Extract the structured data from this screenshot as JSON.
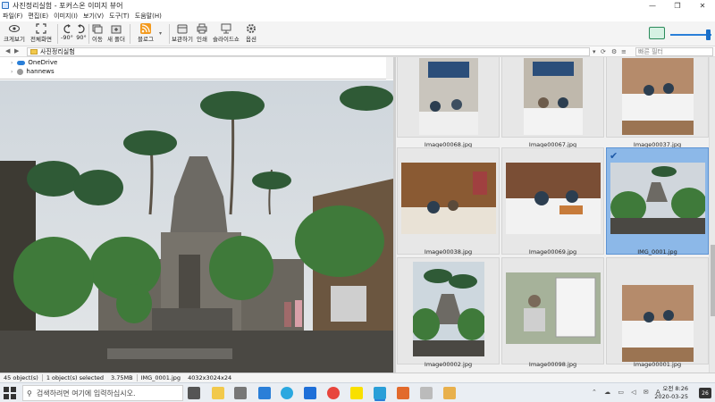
{
  "window": {
    "title": "사진정리실험 - 포커스온 이미지 뷰어",
    "controls": [
      "—",
      "❐",
      "✕"
    ]
  },
  "menu": [
    "파일(F)",
    "편집(E)",
    "이미지(I)",
    "보기(V)",
    "도구(T)",
    "도움말(H)"
  ],
  "toolbar": {
    "buttons": [
      {
        "label": "크게보기",
        "icon": "eye-icon"
      },
      {
        "label": "전체화면",
        "icon": "fullscreen-icon"
      },
      {
        "label": "-90°",
        "icon": "rotate-left-icon"
      },
      {
        "label": "90°",
        "icon": "rotate-right-icon"
      },
      {
        "label": "이동",
        "icon": "move-icon"
      },
      {
        "label": "새 폴더",
        "icon": "new-folder-icon"
      },
      {
        "label": "블로그",
        "icon": "rss-icon"
      },
      {
        "label": "보관하기",
        "icon": "archive-icon"
      },
      {
        "label": "인쇄",
        "icon": "print-icon"
      },
      {
        "label": "슬라이드쇼",
        "icon": "slideshow-icon"
      },
      {
        "label": "옵션",
        "icon": "gear-icon"
      }
    ]
  },
  "address": {
    "path": "사진정리실험",
    "filter_placeholder": "빠른 필터"
  },
  "tree": {
    "items": [
      "OneDrive",
      "hannews"
    ]
  },
  "thumbnails": [
    {
      "name": "Image00068.jpg",
      "selected": false
    },
    {
      "name": "Image00067.jpg",
      "selected": false
    },
    {
      "name": "Image00037.jpg",
      "selected": false
    },
    {
      "name": "Image00038.jpg",
      "selected": false
    },
    {
      "name": "Image00069.jpg",
      "selected": false
    },
    {
      "name": "IMG_0001.jpg",
      "selected": true
    },
    {
      "name": "Image00002.jpg",
      "selected": false
    },
    {
      "name": "Image00098.jpg",
      "selected": false
    },
    {
      "name": "Image00001.jpg",
      "selected": false
    }
  ],
  "status": {
    "count": "45 object(s)",
    "selected": "1 object(s) selected",
    "size": "3.75MB",
    "file": "IMG_0001.jpg",
    "dims": "4032x3024x24"
  },
  "taskbar": {
    "search_placeholder": "검색하려면 여기에 입력하십시오.",
    "time": "오전 8:26",
    "date": "2020-03-25",
    "notification_count": "26"
  },
  "colors": {
    "accent": "#2a7fd8",
    "selected": "#8cb8e8"
  }
}
